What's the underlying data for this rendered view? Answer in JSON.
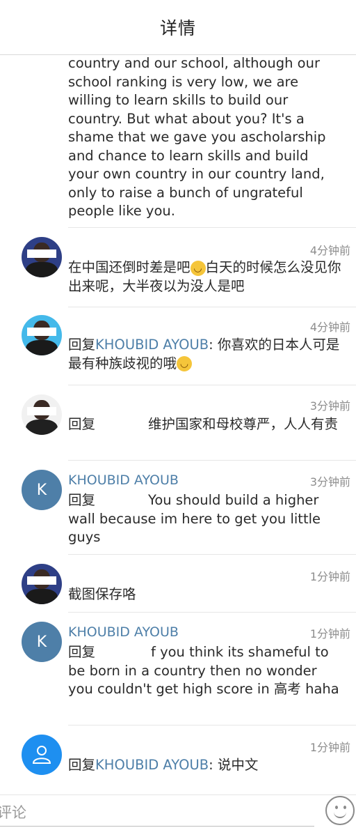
{
  "header": {
    "title": "详情"
  },
  "comments": [
    {
      "text": "country and our school, although our school ranking is very low, we are willing to learn skills to build our country. But what about you? It's a shame that we gave you ascholarship and chance to learn skills and build your own country in our country  land, only to raise a bunch of ungrateful people like you."
    },
    {
      "time": "4分钟前",
      "text_a": "在中国还倒时差是吧",
      "emoji": "😅",
      "text_b": "白天的时候怎么没见你出来呢，大半夜以为没人是吧"
    },
    {
      "time": "4分钟前",
      "reply_prefix": "回复",
      "mention": "KHOUBID AYOUB",
      "text": ": 你喜欢的日本人可是最有种族歧视的哦",
      "emoji": "😃"
    },
    {
      "time": "3分钟前",
      "reply_prefix": "回复",
      "text": "维护国家和母校尊严，人人有责"
    },
    {
      "avatar_letter": "K",
      "name": "KHOUBID AYOUB",
      "time": "3分钟前",
      "reply_prefix": "回复",
      "text": "You should build a higher wall because im here to get you little guys"
    },
    {
      "time": "1分钟前",
      "text": "截图保存咯"
    },
    {
      "avatar_letter": "K",
      "name": "KHOUBID AYOUB",
      "time": "1分钟前",
      "reply_prefix": "回复",
      "text": "f you think its shameful to be born in a country then no wonder you couldn't get high score in 高考 haha"
    },
    {
      "time": "1分钟前",
      "reply_prefix": "回复",
      "mention": "KHOUBID AYOUB",
      "text": ": 说中文"
    }
  ],
  "bottom_bar": {
    "input_placeholder": "评论",
    "emoji_button_icon": "smiley-icon"
  }
}
